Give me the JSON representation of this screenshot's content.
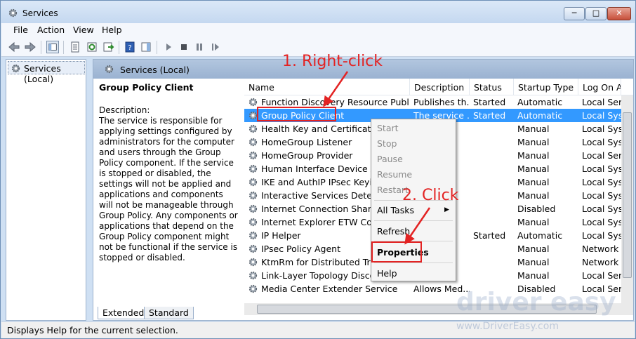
{
  "window": {
    "title": "Services",
    "min": "─",
    "max": "□",
    "close": "✕"
  },
  "menu": [
    "File",
    "Action",
    "View",
    "Help"
  ],
  "tree": {
    "item": "Services (Local)"
  },
  "panel": {
    "header": "Services (Local)",
    "desc_title": "Group Policy Client",
    "desc_label": "Description:",
    "desc_text": "The service is responsible for applying settings configured by administrators for the computer and users through the Group Policy component. If the service is stopped or disabled, the settings will not be applied and applications and components will not be manageable through Group Policy. Any components or applications that depend on the Group Policy component might not be functional if the service is stopped or disabled."
  },
  "columns": [
    "Name",
    "Description",
    "Status",
    "Startup Type",
    "Log On As"
  ],
  "rows": [
    [
      "Function Discovery Resource Publication",
      "Publishes th...",
      "Started",
      "Automatic",
      "Local Service"
    ],
    [
      "Group Policy Client",
      "The service ...",
      "Started",
      "Automatic",
      "Local System"
    ],
    [
      "Health Key and Certificate Management",
      "",
      "",
      "Manual",
      "Local System"
    ],
    [
      "HomeGroup Listener",
      "",
      "",
      "Manual",
      "Local System"
    ],
    [
      "HomeGroup Provider",
      "",
      "",
      "Manual",
      "Local Service"
    ],
    [
      "Human Interface Device Access",
      "",
      "",
      "Manual",
      "Local System"
    ],
    [
      "IKE and AuthIP IPsec Keying Modules",
      "",
      "",
      "Manual",
      "Local System"
    ],
    [
      "Interactive Services Detection",
      "",
      "",
      "Manual",
      "Local System"
    ],
    [
      "Internet Connection Sharing (ICS)",
      "",
      "",
      "Disabled",
      "Local System"
    ],
    [
      "Internet Explorer ETW Collector Service",
      "",
      "",
      "Manual",
      "Local System"
    ],
    [
      "IP Helper",
      "",
      "Started",
      "Automatic",
      "Local System"
    ],
    [
      "IPsec Policy Agent",
      "",
      "",
      "Manual",
      "Network Service"
    ],
    [
      "KtmRm for Distributed Transaction Coordinator",
      "",
      "",
      "Manual",
      "Network Service"
    ],
    [
      "Link-Layer Topology Discovery Mapper",
      "",
      "",
      "Manual",
      "Local Service"
    ],
    [
      "Media Center Extender Service",
      "Allows Med...",
      "",
      "Disabled",
      "Local Service"
    ]
  ],
  "context_menu": {
    "start": "Start",
    "stop": "Stop",
    "pause": "Pause",
    "resume": "Resume",
    "restart": "Restart",
    "all_tasks": "All Tasks",
    "arrow": "▶",
    "refresh": "Refresh",
    "properties": "Properties",
    "help": "Help"
  },
  "tabs": [
    "Extended",
    "Standard"
  ],
  "status_text": "Displays Help for the current selection.",
  "annotations": {
    "step1": "1. Right-click",
    "step2": "2. Click"
  },
  "watermark": {
    "brand": "driver easy",
    "url": "www.DriverEasy.com"
  },
  "colors": {
    "selection": "#3399ff",
    "annotation": "#e32323"
  }
}
